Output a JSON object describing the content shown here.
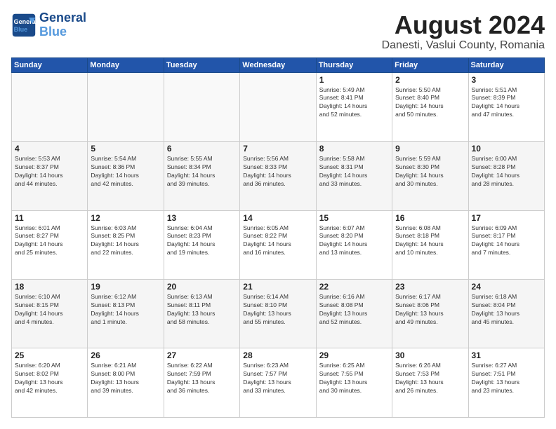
{
  "logo": {
    "line1": "General",
    "line2": "Blue"
  },
  "header": {
    "month": "August 2024",
    "location": "Danesti, Vaslui County, Romania"
  },
  "days_of_week": [
    "Sunday",
    "Monday",
    "Tuesday",
    "Wednesday",
    "Thursday",
    "Friday",
    "Saturday"
  ],
  "weeks": [
    [
      {
        "day": "",
        "info": ""
      },
      {
        "day": "",
        "info": ""
      },
      {
        "day": "",
        "info": ""
      },
      {
        "day": "",
        "info": ""
      },
      {
        "day": "1",
        "info": "Sunrise: 5:49 AM\nSunset: 8:41 PM\nDaylight: 14 hours\nand 52 minutes."
      },
      {
        "day": "2",
        "info": "Sunrise: 5:50 AM\nSunset: 8:40 PM\nDaylight: 14 hours\nand 50 minutes."
      },
      {
        "day": "3",
        "info": "Sunrise: 5:51 AM\nSunset: 8:39 PM\nDaylight: 14 hours\nand 47 minutes."
      }
    ],
    [
      {
        "day": "4",
        "info": "Sunrise: 5:53 AM\nSunset: 8:37 PM\nDaylight: 14 hours\nand 44 minutes."
      },
      {
        "day": "5",
        "info": "Sunrise: 5:54 AM\nSunset: 8:36 PM\nDaylight: 14 hours\nand 42 minutes."
      },
      {
        "day": "6",
        "info": "Sunrise: 5:55 AM\nSunset: 8:34 PM\nDaylight: 14 hours\nand 39 minutes."
      },
      {
        "day": "7",
        "info": "Sunrise: 5:56 AM\nSunset: 8:33 PM\nDaylight: 14 hours\nand 36 minutes."
      },
      {
        "day": "8",
        "info": "Sunrise: 5:58 AM\nSunset: 8:31 PM\nDaylight: 14 hours\nand 33 minutes."
      },
      {
        "day": "9",
        "info": "Sunrise: 5:59 AM\nSunset: 8:30 PM\nDaylight: 14 hours\nand 30 minutes."
      },
      {
        "day": "10",
        "info": "Sunrise: 6:00 AM\nSunset: 8:28 PM\nDaylight: 14 hours\nand 28 minutes."
      }
    ],
    [
      {
        "day": "11",
        "info": "Sunrise: 6:01 AM\nSunset: 8:27 PM\nDaylight: 14 hours\nand 25 minutes."
      },
      {
        "day": "12",
        "info": "Sunrise: 6:03 AM\nSunset: 8:25 PM\nDaylight: 14 hours\nand 22 minutes."
      },
      {
        "day": "13",
        "info": "Sunrise: 6:04 AM\nSunset: 8:23 PM\nDaylight: 14 hours\nand 19 minutes."
      },
      {
        "day": "14",
        "info": "Sunrise: 6:05 AM\nSunset: 8:22 PM\nDaylight: 14 hours\nand 16 minutes."
      },
      {
        "day": "15",
        "info": "Sunrise: 6:07 AM\nSunset: 8:20 PM\nDaylight: 14 hours\nand 13 minutes."
      },
      {
        "day": "16",
        "info": "Sunrise: 6:08 AM\nSunset: 8:18 PM\nDaylight: 14 hours\nand 10 minutes."
      },
      {
        "day": "17",
        "info": "Sunrise: 6:09 AM\nSunset: 8:17 PM\nDaylight: 14 hours\nand 7 minutes."
      }
    ],
    [
      {
        "day": "18",
        "info": "Sunrise: 6:10 AM\nSunset: 8:15 PM\nDaylight: 14 hours\nand 4 minutes."
      },
      {
        "day": "19",
        "info": "Sunrise: 6:12 AM\nSunset: 8:13 PM\nDaylight: 14 hours\nand 1 minute."
      },
      {
        "day": "20",
        "info": "Sunrise: 6:13 AM\nSunset: 8:11 PM\nDaylight: 13 hours\nand 58 minutes."
      },
      {
        "day": "21",
        "info": "Sunrise: 6:14 AM\nSunset: 8:10 PM\nDaylight: 13 hours\nand 55 minutes."
      },
      {
        "day": "22",
        "info": "Sunrise: 6:16 AM\nSunset: 8:08 PM\nDaylight: 13 hours\nand 52 minutes."
      },
      {
        "day": "23",
        "info": "Sunrise: 6:17 AM\nSunset: 8:06 PM\nDaylight: 13 hours\nand 49 minutes."
      },
      {
        "day": "24",
        "info": "Sunrise: 6:18 AM\nSunset: 8:04 PM\nDaylight: 13 hours\nand 45 minutes."
      }
    ],
    [
      {
        "day": "25",
        "info": "Sunrise: 6:20 AM\nSunset: 8:02 PM\nDaylight: 13 hours\nand 42 minutes."
      },
      {
        "day": "26",
        "info": "Sunrise: 6:21 AM\nSunset: 8:00 PM\nDaylight: 13 hours\nand 39 minutes."
      },
      {
        "day": "27",
        "info": "Sunrise: 6:22 AM\nSunset: 7:59 PM\nDaylight: 13 hours\nand 36 minutes."
      },
      {
        "day": "28",
        "info": "Sunrise: 6:23 AM\nSunset: 7:57 PM\nDaylight: 13 hours\nand 33 minutes."
      },
      {
        "day": "29",
        "info": "Sunrise: 6:25 AM\nSunset: 7:55 PM\nDaylight: 13 hours\nand 30 minutes."
      },
      {
        "day": "30",
        "info": "Sunrise: 6:26 AM\nSunset: 7:53 PM\nDaylight: 13 hours\nand 26 minutes."
      },
      {
        "day": "31",
        "info": "Sunrise: 6:27 AM\nSunset: 7:51 PM\nDaylight: 13 hours\nand 23 minutes."
      }
    ]
  ]
}
